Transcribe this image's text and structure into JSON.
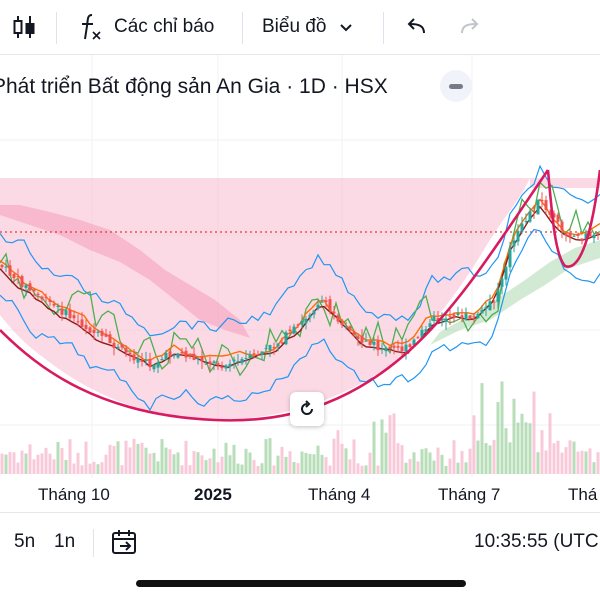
{
  "toolbar": {
    "indicators_label": "Các chỉ báo",
    "chart_type_label": "Biểu đồ"
  },
  "chart": {
    "title": "Phát triển Bất động sản An Gia · 1D · HSX",
    "time_ticks": [
      "Tháng 10",
      "2025",
      "Tháng 4",
      "Tháng 7",
      "Thá"
    ]
  },
  "bottom": {
    "range_5d": "5n",
    "range_1m": "1n",
    "clock": "10:35:55 (UTC"
  },
  "colors": {
    "cup_line": "#d81b60",
    "cloud_bear": "#f8bbd0",
    "cloud_bull": "#c8e6c9",
    "bollinger": "#2196f3",
    "lagging_span": "#4caf50",
    "ma_fast": "#ff6d00",
    "ma_slow": "#8b1a1a",
    "resistance": "#e53935",
    "candle_up": "#26a69a",
    "candle_down": "#ef5350"
  },
  "icons": [
    "candles-icon",
    "indicators-fx-icon",
    "chevron-down-icon",
    "undo-icon",
    "redo-icon",
    "collapse-icon",
    "reset-view-icon",
    "goto-date-icon"
  ]
}
